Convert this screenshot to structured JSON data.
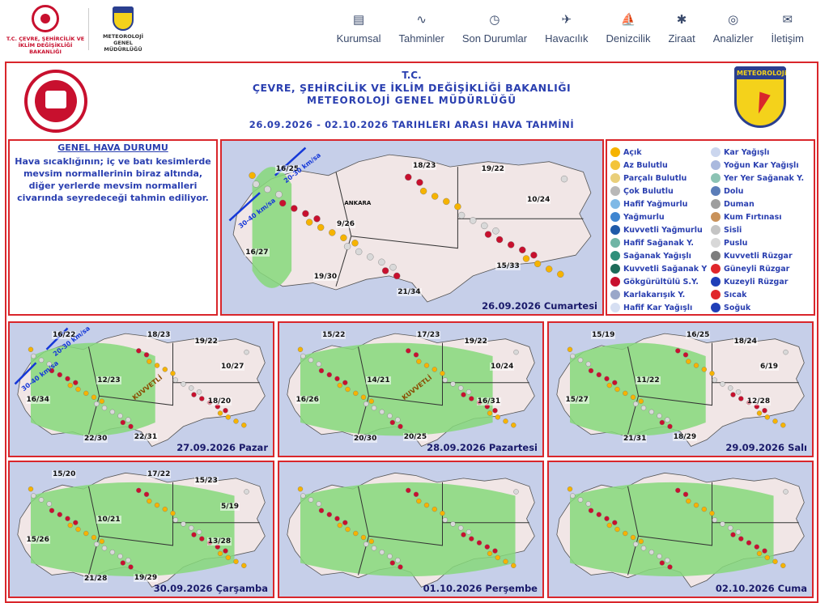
{
  "header": {
    "ministry_logo_caption": "T.C. ÇEVRE, ŞEHİRCİLİK VE İKLİM DEĞİŞİKLİĞİ BAKANLIĞI",
    "mgm_logo_caption": "METEOROLOJİ GENEL MÜDÜRLÜĞÜ",
    "mgm_logo_text": "METEOROLOJi",
    "nav": [
      {
        "label": "Kurumsal",
        "icon": "document-icon",
        "glyph": "▤"
      },
      {
        "label": "Tahminler",
        "icon": "graph-icon",
        "glyph": "∿"
      },
      {
        "label": "Son Durumlar",
        "icon": "clock-check-icon",
        "glyph": "◷"
      },
      {
        "label": "Havacılık",
        "icon": "airplane-icon",
        "glyph": "✈"
      },
      {
        "label": "Denizcilik",
        "icon": "sailboat-icon",
        "glyph": "⛵"
      },
      {
        "label": "Ziraat",
        "icon": "wheat-icon",
        "glyph": "✱"
      },
      {
        "label": "Analizler",
        "icon": "analysis-icon",
        "glyph": "◎"
      },
      {
        "label": "İletişim",
        "icon": "envelope-icon",
        "glyph": "✉"
      }
    ]
  },
  "bulletin": {
    "line1": "T.C.",
    "line2": "ÇEVRE, ŞEHİRCİLİK VE İKLİM DEĞİŞİKLİĞİ BAKANLIĞI",
    "line3": "METEOROLOJİ GENEL MÜDÜRLÜĞÜ",
    "period": "26.09.2026 - 02.10.2026 TARIHLERI ARASI HAVA TAHMİNİ"
  },
  "general": {
    "title": "GENEL HAVA DURUMU",
    "text": "Hava sıcaklığının; iç ve batı kesimlerde mevsim normallerinin biraz altında, diğer yerlerde mevsim normalleri civarında seyredeceği tahmin ediliyor."
  },
  "legend": {
    "left": [
      {
        "label": "Açık",
        "color": "#f6b300"
      },
      {
        "label": "Az Bulutlu",
        "color": "#f3c43a"
      },
      {
        "label": "Parçalı Bulutlu",
        "color": "#e9cf7a"
      },
      {
        "label": "Çok Bulutlu",
        "color": "#b8b8b8"
      },
      {
        "label": "Hafif Yağmurlu",
        "color": "#7fb9e6"
      },
      {
        "label": "Yağmurlu",
        "color": "#3f86d1"
      },
      {
        "label": "Kuvvetli Yağmurlu",
        "color": "#1f5aa8"
      },
      {
        "label": "Hafif Sağanak Y.",
        "color": "#6fb5a5"
      },
      {
        "label": "Sağanak Yağışlı",
        "color": "#2f8f7a"
      },
      {
        "label": "Kuvvetli Sağanak Y",
        "color": "#1d6b59"
      },
      {
        "label": "Gökgürültülü S.Y.",
        "color": "#c8102e"
      },
      {
        "label": "Karlakarışık Y.",
        "color": "#9aa7c9"
      },
      {
        "label": "Hafif Kar Yağışlı",
        "color": "#d6dff2"
      }
    ],
    "right": [
      {
        "label": "Kar Yağışlı",
        "color": "#cbd6ee"
      },
      {
        "label": "Yoğun Kar Yağışlı",
        "color": "#aab9de"
      },
      {
        "label": "Yer Yer Sağanak Y.",
        "color": "#8cc3b4"
      },
      {
        "label": "Dolu",
        "color": "#5b7db8"
      },
      {
        "label": "Duman",
        "color": "#9e9e9e"
      },
      {
        "label": "Kum Fırtınası",
        "color": "#c9925a"
      },
      {
        "label": "Sisli",
        "color": "#c4c4c4"
      },
      {
        "label": "Puslu",
        "color": "#d8d8d8"
      },
      {
        "label": "Kuvvetli Rüzgar",
        "color": "#7d7d7d"
      },
      {
        "label": "Güneyli Rüzgar",
        "color": "#e0262b"
      },
      {
        "label": "Kuzeyli Rüzgar",
        "color": "#1f3fb8"
      },
      {
        "label": "Sıcak",
        "color": "#e0262b"
      },
      {
        "label": "Soğuk",
        "color": "#1f3fb8"
      }
    ]
  },
  "days": [
    {
      "date": "26.09.2026 Cumartesi",
      "temps": [
        {
          "v": "16/25"
        },
        {
          "v": "18/23"
        },
        {
          "v": "19/22"
        },
        {
          "v": "9/26"
        },
        {
          "v": "10/24"
        },
        {
          "v": "16/27"
        },
        {
          "v": "15/33"
        },
        {
          "v": "19/30"
        },
        {
          "v": "21/34"
        }
      ],
      "winds": [
        "30-40 km/sa",
        "20-30 km/sa"
      ],
      "city": "ANKARA",
      "green": 0.12
    },
    {
      "date": "27.09.2026 Pazar",
      "temps": [
        {
          "v": "16/22"
        },
        {
          "v": "18/23"
        },
        {
          "v": "19/22"
        },
        {
          "v": "12/23"
        },
        {
          "v": "10/27"
        },
        {
          "v": "16/34"
        },
        {
          "v": "18/20"
        },
        {
          "v": "22/30"
        },
        {
          "v": "22/31"
        }
      ],
      "winds": [
        "30-40 km/sa",
        "20-30 km/sa"
      ],
      "extra": "KUVVETLİ",
      "green": 0.55
    },
    {
      "date": "28.09.2026 Pazartesi",
      "temps": [
        {
          "v": "15/22"
        },
        {
          "v": "17/23"
        },
        {
          "v": "19/22"
        },
        {
          "v": "14/21"
        },
        {
          "v": "10/24"
        },
        {
          "v": "16/26"
        },
        {
          "v": "16/31"
        },
        {
          "v": "20/30"
        },
        {
          "v": "20/25"
        }
      ],
      "extra": "KUVVETLİ",
      "green": 0.85
    },
    {
      "date": "29.09.2026 Salı",
      "temps": [
        {
          "v": "15/19"
        },
        {
          "v": "16/25"
        },
        {
          "v": "18/24"
        },
        {
          "v": "11/22"
        },
        {
          "v": "6/19"
        },
        {
          "v": "15/27"
        },
        {
          "v": "12/28"
        },
        {
          "v": "21/31"
        },
        {
          "v": "18/29"
        }
      ],
      "green": 0.6
    },
    {
      "date": "30.09.2026 Çarşamba",
      "temps": [
        {
          "v": "15/20"
        },
        {
          "v": "17/22"
        },
        {
          "v": "15/23"
        },
        {
          "v": "10/21"
        },
        {
          "v": "5/19"
        },
        {
          "v": "15/26"
        },
        {
          "v": "13/28"
        },
        {
          "v": "21/28"
        },
        {
          "v": "19/29"
        }
      ],
      "green": 0.9
    },
    {
      "date": "01.10.2026 Perşembe",
      "temps": [],
      "green": 0.95
    },
    {
      "date": "02.10.2026 Cuma",
      "temps": [],
      "green": 0.9
    }
  ]
}
